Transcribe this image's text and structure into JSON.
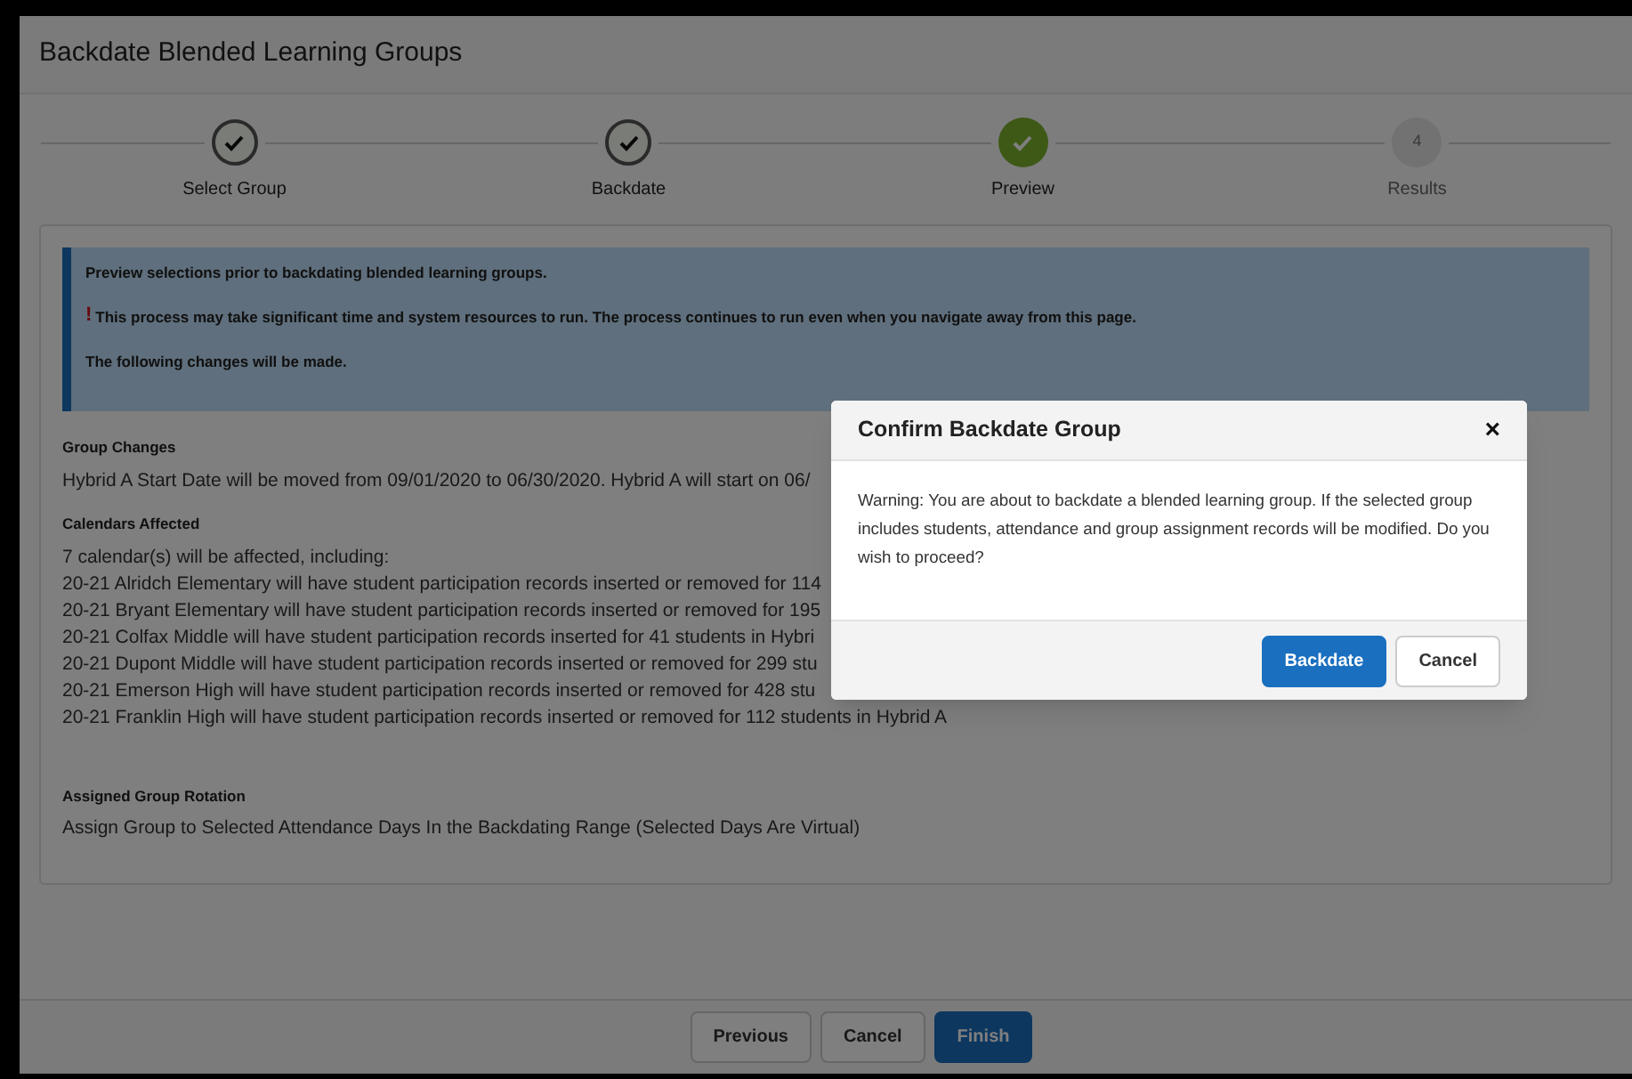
{
  "window": {
    "title": "Backdate Blended Learning Groups"
  },
  "steps": [
    {
      "label": "Select Group",
      "completed": true,
      "selected": false
    },
    {
      "label": "Backdate",
      "completed": true,
      "selected": false
    },
    {
      "label": "Preview",
      "completed": true,
      "selected": true
    },
    {
      "label": "Results",
      "completed": false,
      "selected": false,
      "number": "4"
    }
  ],
  "info": {
    "intro": "Preview selections prior to backdating blended learning groups.",
    "alert_mark": "!",
    "alert": "This process may take significant time and system resources to run. The process continues to run even when you navigate away from this page.",
    "outro": "The following changes will be made."
  },
  "sections": [
    {
      "heading": "Group Changes",
      "lines": [
        "Hybrid A Start Date will be moved from 09/01/2020 to 06/30/2020. Hybrid A will start on 06/"
      ]
    },
    {
      "heading": "Calendars Affected",
      "lines": [
        "7 calendar(s) will be affected, including:",
        "20-21 Alridch Elementary will have student participation records inserted or removed for 114",
        "20-21 Bryant Elementary will have student participation records inserted or removed for 195",
        "20-21 Colfax Middle will have student participation records inserted for 41 students in Hybri",
        "20-21 Dupont Middle will have student participation records inserted or removed for 299 stu",
        "20-21 Emerson High will have student participation records inserted or removed for 428 stu",
        "20-21 Franklin High will have student participation records inserted or removed for 112 students in Hybrid A"
      ]
    },
    {
      "heading": "Assigned Group Rotation",
      "lines": [
        "Assign Group to Selected Attendance Days In the Backdating Range (Selected Days Are Virtual)"
      ]
    }
  ],
  "footer_buttons": [
    {
      "label": "Previous",
      "kind": "secondary"
    },
    {
      "label": "Cancel",
      "kind": "secondary"
    },
    {
      "label": "Finish",
      "kind": "primary"
    }
  ],
  "dialog": {
    "title": "Confirm Backdate Group",
    "close": "×",
    "message": "Warning: You are about to backdate a blended learning group. If the selected group includes students, attendance and group assignment records will be modified. Do you wish to proceed?",
    "buttons": [
      {
        "label": "Backdate",
        "kind": "primary"
      },
      {
        "label": "Cancel",
        "kind": "secondary"
      }
    ]
  }
}
